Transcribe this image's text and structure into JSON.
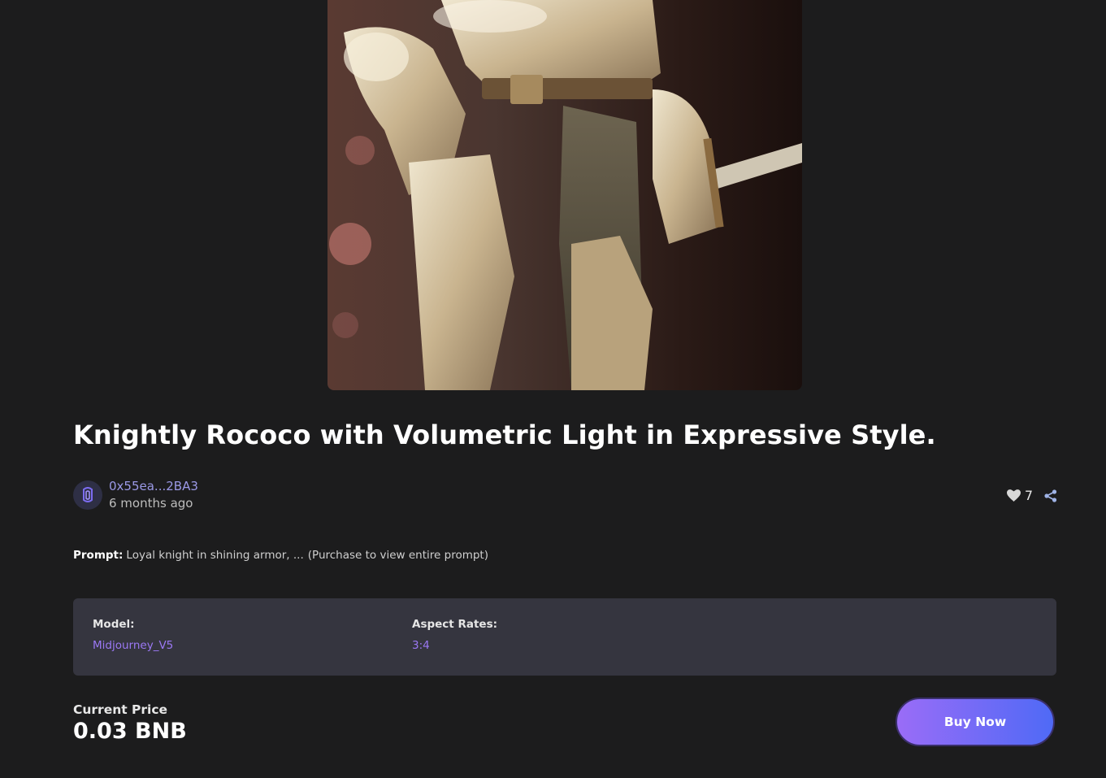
{
  "nft": {
    "title": "Knightly Rococo with Volumetric Light in Expressive Style.",
    "image_icon": "knight-artwork-image"
  },
  "creator": {
    "address": "0x55ea...2BA3",
    "time_ago": "6 months ago",
    "avatar_icon": "creator-avatar-icon"
  },
  "stats": {
    "likes": "7",
    "like_icon": "heart-icon",
    "share_icon": "share-icon"
  },
  "prompt": {
    "label": "Prompt:",
    "text": "Loyal knight in shining armor, ...",
    "note": "(Purchase to view entire prompt)"
  },
  "details": {
    "model_label": "Model:",
    "model_value": "Midjourney_V5",
    "aspect_label": "Aspect Rates:",
    "aspect_value": "3:4"
  },
  "price": {
    "label": "Current Price",
    "value": "0.03 BNB"
  },
  "buy_button": {
    "label": "Buy Now"
  },
  "colors": {
    "background": "#1c1c1d",
    "panel": "#35353f",
    "accent_purple": "#9b78f4",
    "address_color": "#9b99e6",
    "button_gradient_start": "#9a6cf7",
    "button_gradient_end": "#4f6af6"
  }
}
